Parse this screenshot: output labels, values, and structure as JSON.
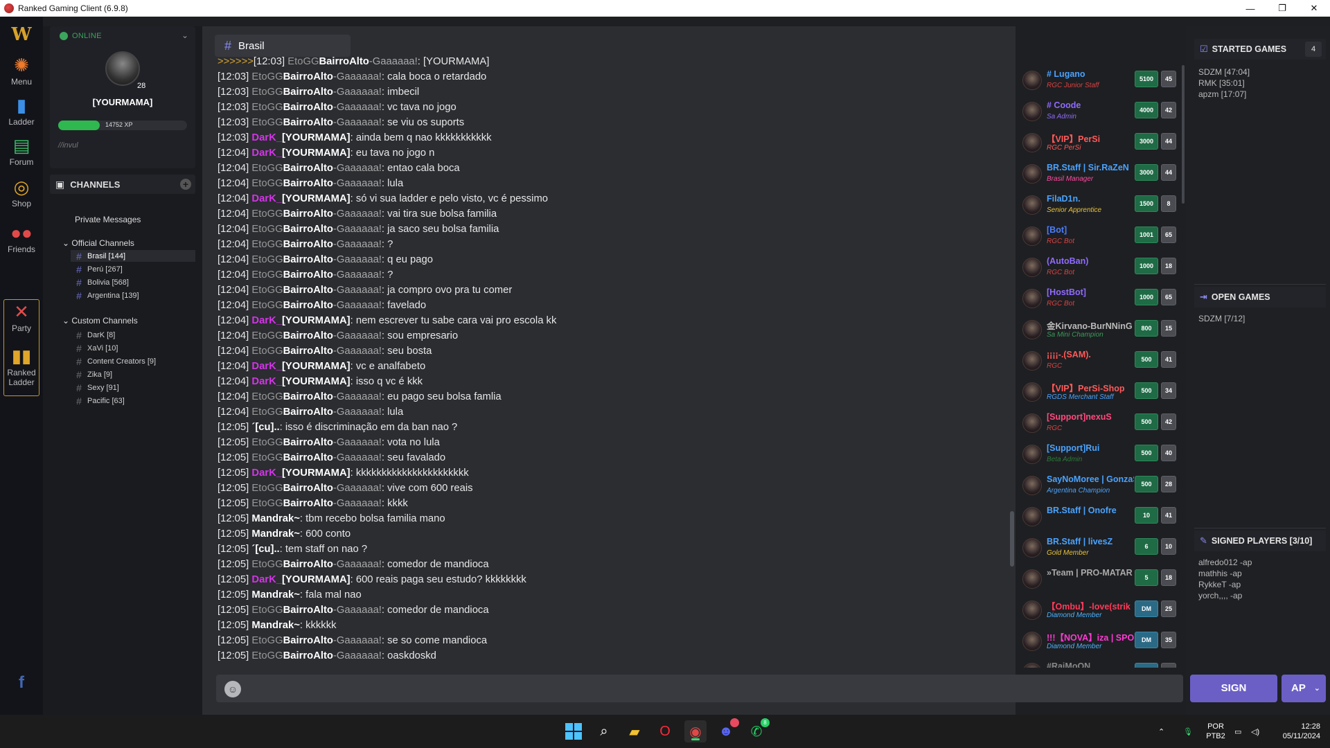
{
  "window": {
    "title": "Ranked Gaming Client (6.9.8)",
    "minimize": "—",
    "maximize": "❐",
    "close": "✕"
  },
  "rail": [
    {
      "label": "Menu",
      "icon": "gear-icon"
    },
    {
      "label": "Ladder",
      "icon": "bar-chart-icon"
    },
    {
      "label": "Forum",
      "icon": "forum-icon"
    },
    {
      "label": "Shop",
      "icon": "coins-icon"
    },
    {
      "label": "Friends",
      "icon": "friends-icon"
    },
    {
      "label": "Party",
      "icon": "crossed-swords-icon"
    },
    {
      "label": "Ranked Ladder",
      "icon": "ranked-bars-icon"
    }
  ],
  "profile": {
    "status": "ONLINE",
    "level": "28",
    "username": "[YOURMAMA]",
    "xp": "14752 XP",
    "xp_fraction": 0.32,
    "motto": "//invul"
  },
  "channels": {
    "header": "CHANNELS",
    "private_messages": "Private Messages",
    "official_title": "Official Channels",
    "official": [
      {
        "name": "Brasil [144]"
      },
      {
        "name": "Perú [267]"
      },
      {
        "name": "Bolivia [568]"
      },
      {
        "name": "Argentina [139]"
      }
    ],
    "custom_title": "Custom Channels",
    "custom": [
      {
        "name": "DarK [8]"
      },
      {
        "name": "XaVi [10]"
      },
      {
        "name": "Content Creators [9]"
      },
      {
        "name": "Zika [9]"
      },
      {
        "name": "Sexy [91]"
      },
      {
        "name": "Pacific [63]"
      }
    ]
  },
  "chat": {
    "channel": "Brasil",
    "messages": [
      {
        "time": "[12:03]",
        "pre": "EtoGG",
        "nick": "BairroAlto",
        "sfx": "-Gaaaaaa!",
        "nick_color": "white",
        "text": ": [YOURMAMA]",
        "lead": ">>>>>>"
      },
      {
        "time": "[12:03]",
        "pre": "EtoGG",
        "nick": "BairroAlto",
        "sfx": "-Gaaaaaa!",
        "nick_color": "white",
        "text": ": cala boca o retardado"
      },
      {
        "time": "[12:03]",
        "pre": "EtoGG",
        "nick": "BairroAlto",
        "sfx": "-Gaaaaaa!",
        "nick_color": "white",
        "text": ": imbecil"
      },
      {
        "time": "[12:03]",
        "pre": "EtoGG",
        "nick": "BairroAlto",
        "sfx": "-Gaaaaaa!",
        "nick_color": "white",
        "text": ": vc tava no jogo"
      },
      {
        "time": "[12:03]",
        "pre": "EtoGG",
        "nick": "BairroAlto",
        "sfx": "-Gaaaaaa!",
        "nick_color": "white",
        "text": ": se viu os suports"
      },
      {
        "time": "[12:03]",
        "pre": "",
        "nick": "DarK_",
        "sfx": "[YOURMAMA]",
        "nick_color": "purple",
        "text": ": ainda bem q nao kkkkkkkkkkk"
      },
      {
        "time": "[12:04]",
        "pre": "",
        "nick": "DarK_",
        "sfx": "[YOURMAMA]",
        "nick_color": "purple",
        "text": ": eu tava no jogo n"
      },
      {
        "time": "[12:04]",
        "pre": "EtoGG",
        "nick": "BairroAlto",
        "sfx": "-Gaaaaaa!",
        "nick_color": "white",
        "text": ": entao cala boca"
      },
      {
        "time": "[12:04]",
        "pre": "EtoGG",
        "nick": "BairroAlto",
        "sfx": "-Gaaaaaa!",
        "nick_color": "white",
        "text": ": lula"
      },
      {
        "time": "[12:04]",
        "pre": "",
        "nick": "DarK_",
        "sfx": "[YOURMAMA]",
        "nick_color": "purple",
        "text": ": só vi sua ladder e pelo visto, vc é pessimo"
      },
      {
        "time": "[12:04]",
        "pre": "EtoGG",
        "nick": "BairroAlto",
        "sfx": "-Gaaaaaa!",
        "nick_color": "white",
        "text": ": vai tira sue bolsa familia"
      },
      {
        "time": "[12:04]",
        "pre": "EtoGG",
        "nick": "BairroAlto",
        "sfx": "-Gaaaaaa!",
        "nick_color": "white",
        "text": ": ja saco seu bolsa familia"
      },
      {
        "time": "[12:04]",
        "pre": "EtoGG",
        "nick": "BairroAlto",
        "sfx": "-Gaaaaaa!",
        "nick_color": "white",
        "text": ": ?"
      },
      {
        "time": "[12:04]",
        "pre": "EtoGG",
        "nick": "BairroAlto",
        "sfx": "-Gaaaaaa!",
        "nick_color": "white",
        "text": ": q eu pago"
      },
      {
        "time": "[12:04]",
        "pre": "EtoGG",
        "nick": "BairroAlto",
        "sfx": "-Gaaaaaa!",
        "nick_color": "white",
        "text": ": ?"
      },
      {
        "time": "[12:04]",
        "pre": "EtoGG",
        "nick": "BairroAlto",
        "sfx": "-Gaaaaaa!",
        "nick_color": "white",
        "text": ": ja compro ovo pra tu comer"
      },
      {
        "time": "[12:04]",
        "pre": "EtoGG",
        "nick": "BairroAlto",
        "sfx": "-Gaaaaaa!",
        "nick_color": "white",
        "text": ": favelado"
      },
      {
        "time": "[12:04]",
        "pre": "",
        "nick": "DarK_",
        "sfx": "[YOURMAMA]",
        "nick_color": "purple",
        "text": ": nem escrever tu sabe cara vai pro escola kk"
      },
      {
        "time": "[12:04]",
        "pre": "EtoGG",
        "nick": "BairroAlto",
        "sfx": "-Gaaaaaa!",
        "nick_color": "white",
        "text": ": sou empresario"
      },
      {
        "time": "[12:04]",
        "pre": "EtoGG",
        "nick": "BairroAlto",
        "sfx": "-Gaaaaaa!",
        "nick_color": "white",
        "text": ": seu bosta"
      },
      {
        "time": "[12:04]",
        "pre": "",
        "nick": "DarK_",
        "sfx": "[YOURMAMA]",
        "nick_color": "purple",
        "text": ": vc e analfabeto"
      },
      {
        "time": "[12:04]",
        "pre": "",
        "nick": "DarK_",
        "sfx": "[YOURMAMA]",
        "nick_color": "purple",
        "text": ": isso q vc é kkk"
      },
      {
        "time": "[12:04]",
        "pre": "EtoGG",
        "nick": "BairroAlto",
        "sfx": "-Gaaaaaa!",
        "nick_color": "white",
        "text": ": eu pago seu bolsa famlia"
      },
      {
        "time": "[12:04]",
        "pre": "EtoGG",
        "nick": "BairroAlto",
        "sfx": "-Gaaaaaa!",
        "nick_color": "white",
        "text": ": lula"
      },
      {
        "time": "[12:05]",
        "pre": "",
        "nick": "´[cu]..",
        "sfx": "",
        "nick_color": "white",
        "text": ": isso é discriminação em da ban nao ?"
      },
      {
        "time": "[12:05]",
        "pre": "EtoGG",
        "nick": "BairroAlto",
        "sfx": "-Gaaaaaa!",
        "nick_color": "white",
        "text": ": vota no lula"
      },
      {
        "time": "[12:05]",
        "pre": "EtoGG",
        "nick": "BairroAlto",
        "sfx": "-Gaaaaaa!",
        "nick_color": "white",
        "text": ": seu favalado"
      },
      {
        "time": "[12:05]",
        "pre": "",
        "nick": "DarK_",
        "sfx": "[YOURMAMA]",
        "nick_color": "purple",
        "text": ": kkkkkkkkkkkkkkkkkkkkkk"
      },
      {
        "time": "[12:05]",
        "pre": "EtoGG",
        "nick": "BairroAlto",
        "sfx": "-Gaaaaaa!",
        "nick_color": "white",
        "text": ": vive com 600 reais"
      },
      {
        "time": "[12:05]",
        "pre": "EtoGG",
        "nick": "BairroAlto",
        "sfx": "-Gaaaaaa!",
        "nick_color": "white",
        "text": ": kkkk"
      },
      {
        "time": "[12:05]",
        "pre": "",
        "nick": "Mandrak~",
        "sfx": "",
        "nick_color": "white",
        "text": ": tbm recebo bolsa familia mano"
      },
      {
        "time": "[12:05]",
        "pre": "",
        "nick": "Mandrak~",
        "sfx": "",
        "nick_color": "white",
        "text": ": 600 conto"
      },
      {
        "time": "[12:05]",
        "pre": "",
        "nick": "´[cu]..",
        "sfx": "",
        "nick_color": "white",
        "text": ": tem staff on nao ?"
      },
      {
        "time": "[12:05]",
        "pre": "EtoGG",
        "nick": "BairroAlto",
        "sfx": "-Gaaaaaa!",
        "nick_color": "white",
        "text": ": comedor de mandioca"
      },
      {
        "time": "[12:05]",
        "pre": "",
        "nick": "DarK_",
        "sfx": "[YOURMAMA]",
        "nick_color": "purple",
        "text": ": 600 reais paga seu estudo? kkkkkkkk"
      },
      {
        "time": "[12:05]",
        "pre": "",
        "nick": "Mandrak~",
        "sfx": "",
        "nick_color": "white",
        "text": ": fala mal nao"
      },
      {
        "time": "[12:05]",
        "pre": "EtoGG",
        "nick": "BairroAlto",
        "sfx": "-Gaaaaaa!",
        "nick_color": "white",
        "text": ": comedor de mandioca"
      },
      {
        "time": "[12:05]",
        "pre": "",
        "nick": "Mandrak~",
        "sfx": "",
        "nick_color": "white",
        "text": ": kkkkkk"
      },
      {
        "time": "[12:05]",
        "pre": "EtoGG",
        "nick": "BairroAlto",
        "sfx": "-Gaaaaaa!",
        "nick_color": "white",
        "text": ": se so come mandioca"
      },
      {
        "time": "[12:05]",
        "pre": "EtoGG",
        "nick": "BairroAlto",
        "sfx": "-Gaaaaaa!",
        "nick_color": "white",
        "text": ": oaskdoskd"
      }
    ]
  },
  "players": [
    {
      "name": "# Lugano",
      "sub": "RGC Junior Staff",
      "name_color": "#4aa3ff",
      "sub_color": "#d94242",
      "pts": "5100",
      "num": "45",
      "dm": false
    },
    {
      "name": "# Coode",
      "sub": "Sa Admin",
      "name_color": "#8f6bff",
      "sub_color": "#8f6bff",
      "pts": "4000",
      "num": "42",
      "dm": false
    },
    {
      "name": "【VIP】PerSi",
      "sub": "RGC PerSi",
      "name_color": "#ff5a5a",
      "sub_color": "#ff5a5a",
      "pts": "3000",
      "num": "44",
      "dm": false
    },
    {
      "name": "BR.Staff | Sir.RaZeN",
      "sub": "Brasil Manager",
      "name_color": "#4aa3ff",
      "sub_color": "#ff4aa3",
      "pts": "3000",
      "num": "44",
      "dm": false
    },
    {
      "name": "FilaD1n.",
      "sub": "Senior Apprentice",
      "name_color": "#4aa3ff",
      "sub_color": "#e8c23a",
      "pts": "1500",
      "num": "8",
      "dm": false
    },
    {
      "name": "[Bot]",
      "sub": "RGC Bot",
      "name_color": "#4a7dff",
      "sub_color": "#d94242",
      "pts": "1001",
      "num": "65",
      "dm": false
    },
    {
      "name": "(AutoBan)",
      "sub": "RGC Bot",
      "name_color": "#8f6bff",
      "sub_color": "#d94242",
      "pts": "1000",
      "num": "18",
      "dm": false
    },
    {
      "name": "[HostBot]",
      "sub": "RGC Bot",
      "name_color": "#8f6bff",
      "sub_color": "#d94242",
      "pts": "1000",
      "num": "65",
      "dm": false
    },
    {
      "name": "金Kirvano-BurNNinG",
      "sub": "Sa Mini Champion",
      "name_color": "#bbbbbb",
      "sub_color": "#3a9b5a",
      "pts": "800",
      "num": "15",
      "dm": false
    },
    {
      "name": "¡¡¡¡-.(SAM).",
      "sub": "RGC",
      "name_color": "#ff5a5a",
      "sub_color": "#d94242",
      "pts": "500",
      "num": "41",
      "dm": false
    },
    {
      "name": "【VIP】PerSi-Shop",
      "sub": "RGDS Merchant Staff",
      "name_color": "#ff5a5a",
      "sub_color": "#4aa3ff",
      "pts": "500",
      "num": "34",
      "dm": false
    },
    {
      "name": "[Support]nexuS",
      "sub": "RGC",
      "name_color": "#ff4a7d",
      "sub_color": "#d94242",
      "pts": "500",
      "num": "42",
      "dm": false
    },
    {
      "name": "[Support]Rui",
      "sub": "Beta Admin",
      "name_color": "#4aa3ff",
      "sub_color": "#2b7a3a",
      "pts": "500",
      "num": "40",
      "dm": false
    },
    {
      "name": "SayNoMoree | GonzaS",
      "sub": "Argentina Champion",
      "name_color": "#4aa3ff",
      "sub_color": "#4aa3ff",
      "pts": "500",
      "num": "28",
      "dm": false
    },
    {
      "name": "BR.Staff | Onofre",
      "sub": "",
      "name_color": "#4aa3ff",
      "sub_color": "#4aa3ff",
      "pts": "10",
      "num": "41",
      "dm": false
    },
    {
      "name": "BR.Staff | livesZ",
      "sub": "Gold Member",
      "name_color": "#4aa3ff",
      "sub_color": "#e8c23a",
      "pts": "6",
      "num": "10",
      "dm": false
    },
    {
      "name": "»Team | PRO-MATAR",
      "sub": "",
      "name_color": "#aaaaaa",
      "sub_color": "#aaaaaa",
      "pts": "5",
      "num": "18",
      "dm": false
    },
    {
      "name": "【Ombu】-love(strik",
      "sub": "Diamond Member",
      "name_color": "#ff3a5a",
      "sub_color": "#4ab3ff",
      "pts": "DM",
      "num": "25",
      "dm": true
    },
    {
      "name": "!!!【NOVA】iza | SPORT",
      "sub": "Diamond Member",
      "name_color": "#ff3ad4",
      "sub_color": "#4ab3ff",
      "pts": "DM",
      "num": "35",
      "dm": true
    },
    {
      "name": "#RaiMoON",
      "sub": "",
      "name_color": "#888888",
      "sub_color": "#888888",
      "pts": "DM",
      "num": "",
      "dm": true
    }
  ],
  "right": {
    "started_title": "STARTED GAMES",
    "started_count": "4",
    "started": [
      "SDZM [47:04]",
      "RMK [35:01]",
      "apzm [17:07]"
    ],
    "open_title": "OPEN GAMES",
    "open": [
      "SDZM [7/12]"
    ],
    "signed_title": "SIGNED PLAYERS [3/10]",
    "signed": [
      "alfredo012 -ap",
      "mathhis -ap",
      "RykkeT -ap",
      "yorch,,,, -ap"
    ],
    "sign_button": "SIGN",
    "ap_button": "AP"
  },
  "taskbar": {
    "lang_top": "POR",
    "lang_bottom": "PTB2",
    "time": "12:28",
    "date": "05/11/2024",
    "discord_badge": "",
    "whatsapp_badge": "8"
  },
  "colors": {
    "accent": "#6b5fc6",
    "online": "#3ba55d",
    "purple_nick": "#d434e8",
    "channel_hash": "#6b6cc8"
  }
}
